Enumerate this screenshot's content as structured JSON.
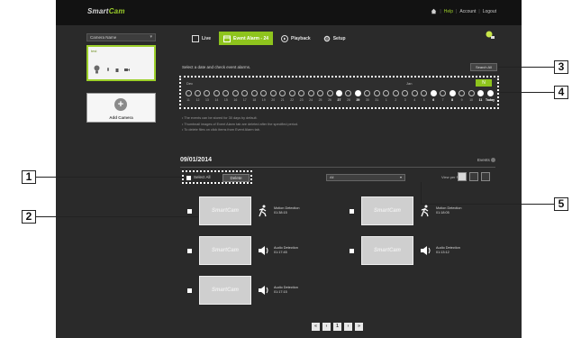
{
  "brand": {
    "name": "Smart",
    "accent": "Cam",
    "accent_color": "#9ccf2a"
  },
  "top_links": {
    "home_icon": "home-icon",
    "items": [
      "Help",
      "Account",
      "Logout"
    ]
  },
  "sidebar": {
    "camera_select": "Camera Name",
    "camera_name": "test",
    "add_camera_label": "Add Camera"
  },
  "tabs": [
    {
      "label": "Live",
      "icon": "monitor-icon"
    },
    {
      "label": "Event Alarm - 24",
      "icon": "calendar-icon",
      "active": true
    },
    {
      "label": "Playback",
      "icon": "play-icon"
    },
    {
      "label": "Setup",
      "icon": "gear-icon"
    }
  ],
  "prompt": "Select a date and check event alarms.",
  "search_button": "Search All",
  "timeline": {
    "month_left": "Dec",
    "month_right": "Jan",
    "go_label": "N",
    "dates": [
      {
        "d": "11",
        "ev": false
      },
      {
        "d": "12",
        "ev": false
      },
      {
        "d": "13",
        "ev": false
      },
      {
        "d": "14",
        "ev": false
      },
      {
        "d": "15",
        "ev": false
      },
      {
        "d": "16",
        "ev": false
      },
      {
        "d": "17",
        "ev": false
      },
      {
        "d": "18",
        "ev": false
      },
      {
        "d": "19",
        "ev": false
      },
      {
        "d": "20",
        "ev": false
      },
      {
        "d": "21",
        "ev": false
      },
      {
        "d": "22",
        "ev": false
      },
      {
        "d": "23",
        "ev": false
      },
      {
        "d": "24",
        "ev": false
      },
      {
        "d": "25",
        "ev": false
      },
      {
        "d": "26",
        "ev": false
      },
      {
        "d": "27",
        "ev": true
      },
      {
        "d": "28",
        "ev": false
      },
      {
        "d": "29",
        "ev": true
      },
      {
        "d": "30",
        "ev": false
      },
      {
        "d": "31",
        "ev": false
      },
      {
        "d": "1",
        "ev": false
      },
      {
        "d": "2",
        "ev": false
      },
      {
        "d": "3",
        "ev": false
      },
      {
        "d": "4",
        "ev": false
      },
      {
        "d": "5",
        "ev": false
      },
      {
        "d": "6",
        "ev": true
      },
      {
        "d": "7",
        "ev": false
      },
      {
        "d": "8",
        "ev": true
      },
      {
        "d": "9",
        "ev": false
      },
      {
        "d": "10",
        "ev": false
      },
      {
        "d": "11",
        "ev": true
      },
      {
        "d": "Today",
        "ev": true
      }
    ]
  },
  "notes": [
    "• The events can be stored for 30 days by default.",
    "• Thumbnail images of Event Alarm tab are deleted after the specified period.",
    "• To delete files on click items from Event Alarm tab."
  ],
  "list": {
    "date": "09/01/2014",
    "events_label": "Events",
    "select_all": "Select All",
    "delete": "Delete",
    "filter_value": "All",
    "per_page_label": "View per Page"
  },
  "clips": [
    {
      "thumb": "SmartCam",
      "icon": "motion-icon",
      "type": "Motion Detection",
      "time": "01:38:15"
    },
    {
      "thumb": "SmartCam",
      "icon": "motion-icon",
      "type": "Motion Detection",
      "time": "01:18:05"
    },
    {
      "thumb": "SmartCam",
      "icon": "audio-icon",
      "type": "Audio Detection",
      "time": "01:17:45"
    },
    {
      "thumb": "SmartCam",
      "icon": "audio-icon",
      "type": "Audio Detection",
      "time": "01:13:12"
    },
    {
      "thumb": "SmartCam",
      "icon": "audio-icon",
      "type": "Audio Detection",
      "time": "01:17:15"
    }
  ],
  "pager": [
    "«",
    "‹",
    "1",
    "›",
    "»"
  ],
  "callouts": [
    "1",
    "2",
    "3",
    "4",
    "5"
  ]
}
